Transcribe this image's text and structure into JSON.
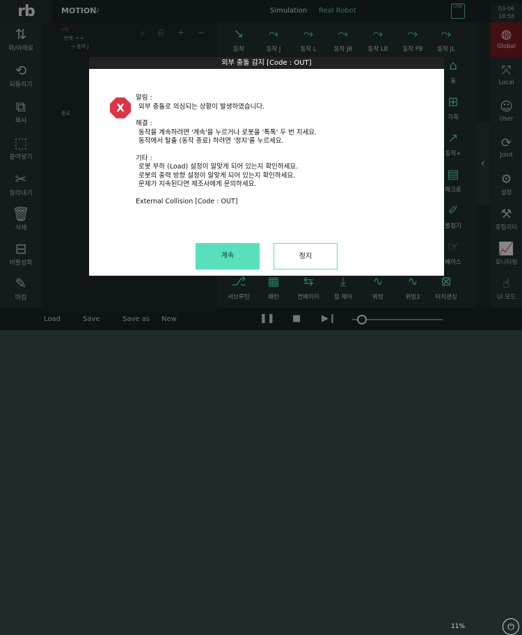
{
  "top": {
    "logo": "rb",
    "menu_title": "MOTION",
    "sync_icon": "↻",
    "simulation": "Simulation",
    "real_robot": "Real Robot",
    "usb": "USB",
    "date": "03-06",
    "time": "18:58"
  },
  "left_menu": [
    {
      "icon": "⇅",
      "label": "위/아래로"
    },
    {
      "icon": "⟲",
      "label": "되돌리기"
    },
    {
      "icon": "⧉",
      "label": "복사"
    },
    {
      "icon": "⬚",
      "label": "붙여넣기"
    },
    {
      "icon": "✂",
      "label": "잘라내기"
    },
    {
      "icon": "🗑",
      "label": "삭제"
    },
    {
      "icon": "⊟",
      "label": "비활성화"
    },
    {
      "icon": "✎",
      "label": "마킹"
    }
  ],
  "right_menu": [
    {
      "icon": "◍",
      "label": "Global"
    },
    {
      "icon": "⤧",
      "label": "Local"
    },
    {
      "icon": "☺",
      "label": "User"
    },
    {
      "icon": "⟳",
      "label": "Joint"
    },
    {
      "icon": "⚙",
      "label": "설정"
    },
    {
      "icon": "⚒",
      "label": "유틸리티"
    },
    {
      "icon": "📈",
      "label": "모니터링"
    },
    {
      "icon": "☝",
      "label": "UI 모드"
    }
  ],
  "tree": {
    "start": "시작",
    "repeat": "반복 → ∞",
    "move": "→ 동작 J",
    "end": "종료"
  },
  "commands_top": [
    {
      "icon": "↘",
      "label": "동작"
    },
    {
      "icon": "⤳",
      "label": "동작 J"
    },
    {
      "icon": "⤳",
      "label": "동작 L"
    },
    {
      "icon": "⤳",
      "label": "동작 JB"
    },
    {
      "icon": "⤳",
      "label": "동작 LB"
    },
    {
      "icon": "⤳",
      "label": "동작 PB"
    },
    {
      "icon": "⤳",
      "label": "동작 JL"
    }
  ],
  "commands_bottom": [
    {
      "icon": "⎇",
      "label": "서브루틴"
    },
    {
      "icon": "▦",
      "label": "패턴"
    },
    {
      "icon": "⇆",
      "label": "컨베이어"
    },
    {
      "icon": "⤓",
      "label": "힘 제어"
    },
    {
      "icon": "∿",
      "label": "위빙"
    },
    {
      "icon": "∿",
      "label": "위빙2"
    },
    {
      "icon": "⊠",
      "label": "터치센싱"
    }
  ],
  "commands_hidden": {
    "home": "홈",
    "add": "가축",
    "move_plus": "동작+",
    "macro": "매크로",
    "fold": "폴접기",
    "interface": "페이스"
  },
  "bottom": {
    "load": "Load",
    "save": "Save",
    "save_as": "Save as",
    "new": "New",
    "speed": "11%",
    "speed_fraction": 0.11
  },
  "dialog": {
    "title": "외부 충돌 감지 [Code : OUT]",
    "icon_letter": "X",
    "alert_heading": "알림 :",
    "alert_text": "외부 충돌로 의심되는 상황이 발생하였습니다.",
    "solution_heading": "해결 :",
    "solution_1": "동작을 계속하려면 '계속'을 누르거나 로봇을 '톡톡' 두 번 치세요.",
    "solution_2": "동작에서 탈출 (동작 종료) 하려면 '정지'를 누르세요.",
    "etc_heading": "기타 :",
    "etc_1": "로봇 부하 (Load) 설정이 알맞게 되어 있는지 확인하세요.",
    "etc_2": "로봇의 중력 방향 설정이 알맞게 되어 있는지 확인하세요.",
    "etc_3": "문제가 지속된다면 제조사에게 문의하세요.",
    "code_line": "External Collision [Code : OUT]",
    "continue_label": "계속",
    "stop_label": "정지"
  }
}
